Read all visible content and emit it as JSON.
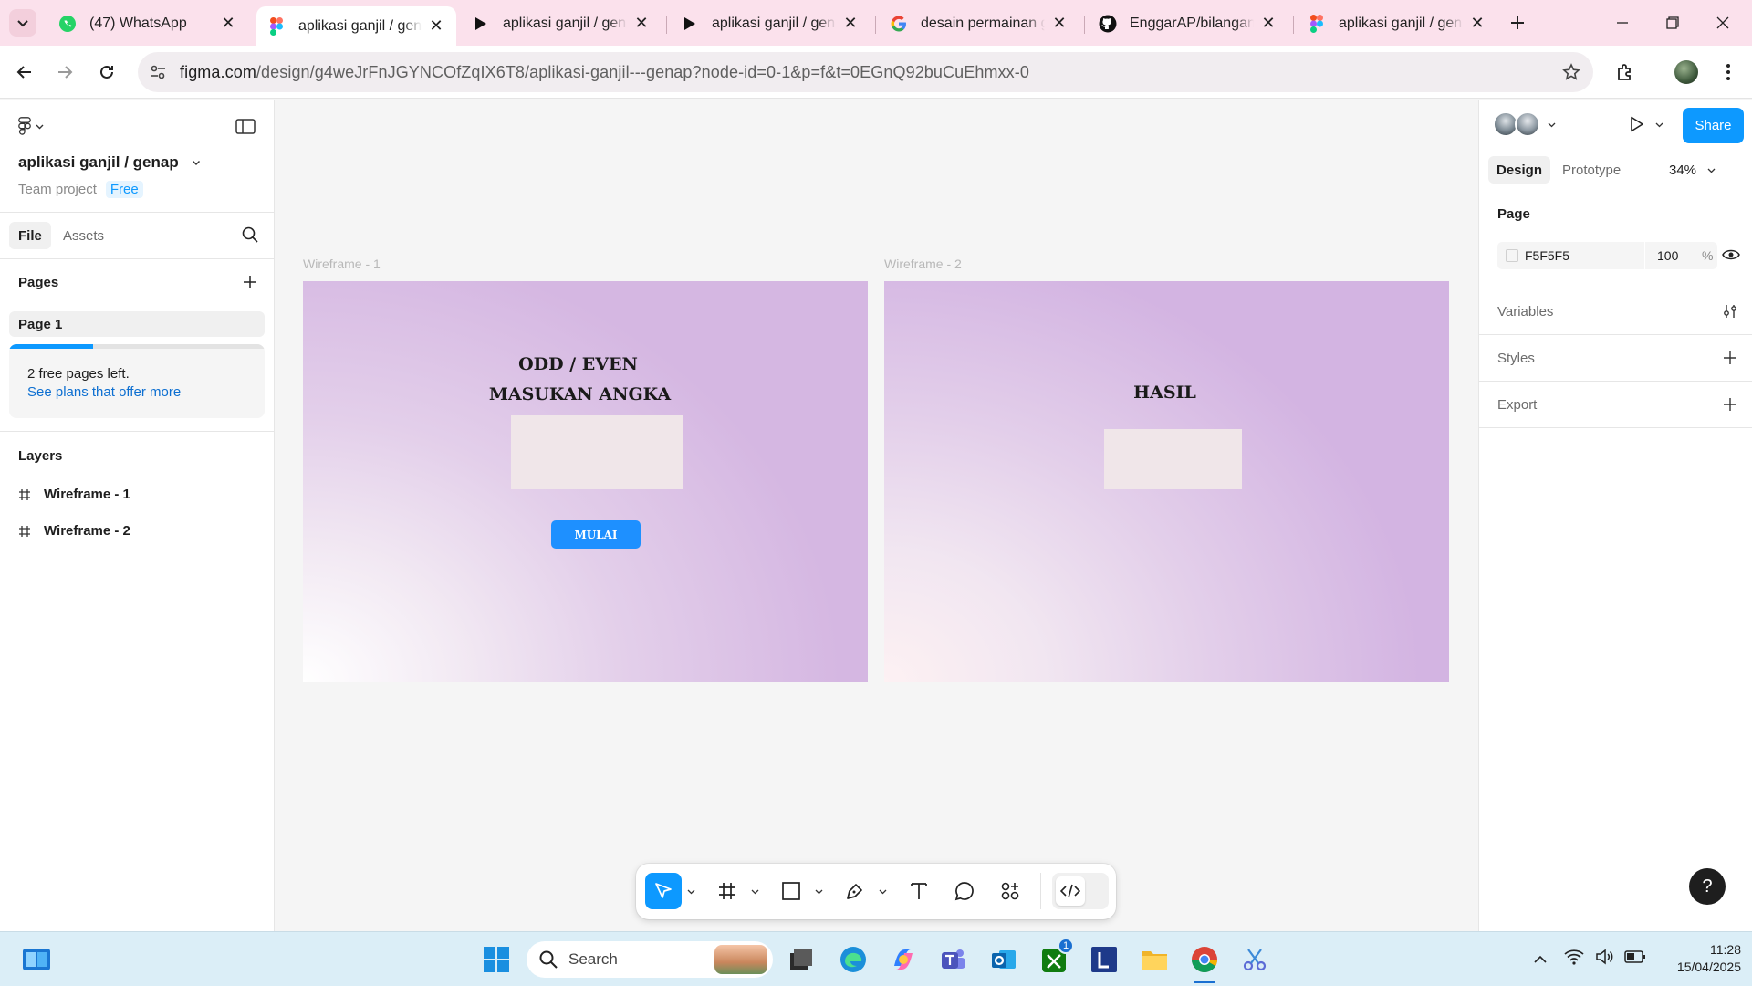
{
  "browser": {
    "tabs": [
      {
        "label": "(47) WhatsApp",
        "icon": "whatsapp-icon"
      },
      {
        "label": "aplikasi ganjil / genap",
        "icon": "figma-icon",
        "active": true
      },
      {
        "label": "aplikasi ganjil / genap",
        "icon": "play-icon"
      },
      {
        "label": "aplikasi ganjil / genap",
        "icon": "play-icon"
      },
      {
        "label": "desain permainan ganjil",
        "icon": "google-icon"
      },
      {
        "label": "EnggarAP/bilangan-ganjil",
        "icon": "github-icon"
      },
      {
        "label": "aplikasi ganjil / genap",
        "icon": "figma-icon"
      }
    ],
    "url_domain": "figma.com",
    "url_path": "/design/g4weJrFnJGYNCOfZqIX6T8/aplikasi-ganjil---genap?node-id=0-1&p=f&t=0EGnQ92buCuEhmxx-0"
  },
  "left_panel": {
    "file_name": "aplikasi ganjil / genap",
    "team": "Team project",
    "plan_badge": "Free",
    "tabs": [
      "File",
      "Assets"
    ],
    "pages_title": "Pages",
    "pages": [
      "Page 1"
    ],
    "free_pages_note": "2 free pages left.",
    "plans_link": "See plans that offer more",
    "free_pages_progress": 0.33,
    "layers_title": "Layers",
    "layers": [
      "Wireframe - 1",
      "Wireframe - 2"
    ]
  },
  "canvas": {
    "frame1": {
      "label": "Wireframe - 1",
      "title_line1": "ODD / EVEN",
      "title_line2": "MASUKAN ANGKA",
      "button": "MULAI"
    },
    "frame2": {
      "label": "Wireframe - 2",
      "title": "HASIL"
    }
  },
  "right_panel": {
    "tabs": [
      "Design",
      "Prototype"
    ],
    "zoom": "34%",
    "share": "Share",
    "page_title": "Page",
    "page_color": "F5F5F5",
    "page_opacity": "100",
    "percent": "%",
    "sections": [
      "Variables",
      "Styles",
      "Export"
    ]
  },
  "taskbar": {
    "search_placeholder": "Search",
    "time": "11:28",
    "date": "15/04/2025",
    "outlook_badge": "1"
  },
  "colors": {
    "accent": "#0d99ff",
    "button": "#1e90ff",
    "input_fill": "#f0e6e9"
  }
}
